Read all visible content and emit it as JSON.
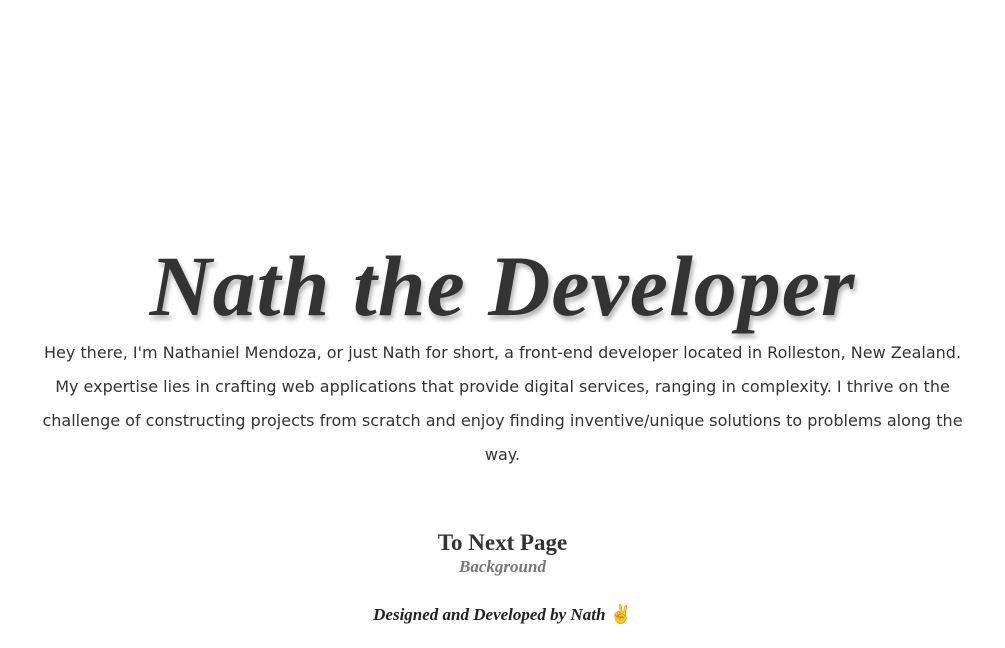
{
  "hero": {
    "title": "Nath the Developer",
    "intro": "Hey there, I'm Nathaniel Mendoza, or just Nath for short, a front-end developer located in Rolleston, New Zealand. My expertise lies in crafting web applications that provide digital services, ranging in complexity. I thrive on the challenge of constructing projects from scratch and enjoy finding inventive/unique solutions to problems along the way."
  },
  "nav": {
    "next_label": "To Next Page",
    "next_sub": "Background"
  },
  "footer": {
    "text": "Designed and Developed by Nath",
    "icon": "victory-hand-icon"
  }
}
